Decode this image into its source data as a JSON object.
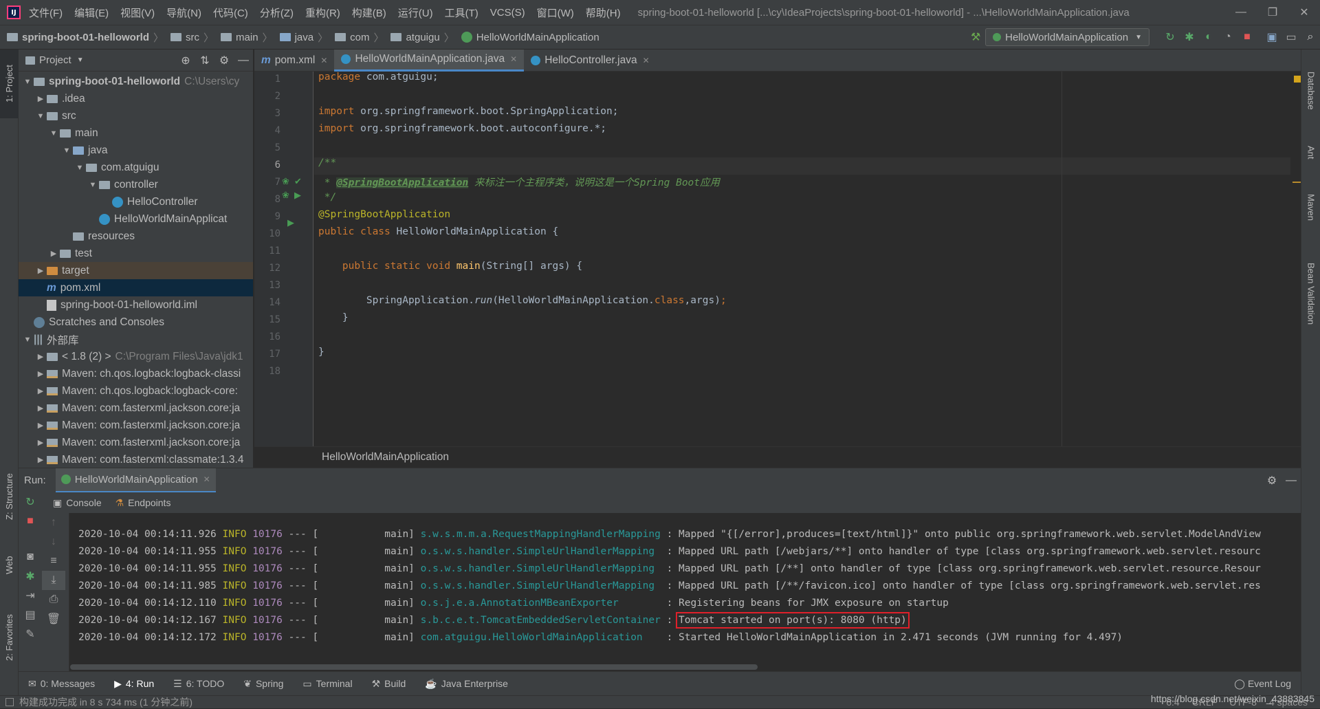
{
  "menubar": {
    "items": [
      "文件(F)",
      "编辑(E)",
      "视图(V)",
      "导航(N)",
      "代码(C)",
      "分析(Z)",
      "重构(R)",
      "构建(B)",
      "运行(U)",
      "工具(T)",
      "VCS(S)",
      "窗口(W)",
      "帮助(H)"
    ],
    "window_title": "spring-boot-01-helloworld [...\\cy\\IdeaProjects\\spring-boot-01-helloworld] - ...\\HelloWorldMainApplication.java"
  },
  "navbar": {
    "crumbs": [
      "spring-boot-01-helloworld",
      "src",
      "main",
      "java",
      "com",
      "atguigu",
      "HelloWorldMainApplication"
    ],
    "run_config": "HelloWorldMainApplication"
  },
  "left_strip": {
    "project": "1: Project",
    "structure": "Z: Structure",
    "web": "Web",
    "favorites": "2: Favorites"
  },
  "right_strip": {
    "database": "Database",
    "ant": "Ant",
    "maven": "Maven",
    "bean_validation": "Bean Validation"
  },
  "project_panel": {
    "title": "Project",
    "tree": [
      {
        "label": "spring-boot-01-helloworld",
        "extra": "C:\\Users\\cy",
        "depth": 0,
        "arrow": "▼",
        "icon": "folder",
        "bold": true
      },
      {
        "label": ".idea",
        "depth": 1,
        "arrow": "▶",
        "icon": "folder"
      },
      {
        "label": "src",
        "depth": 1,
        "arrow": "▼",
        "icon": "folder"
      },
      {
        "label": "main",
        "depth": 2,
        "arrow": "▼",
        "icon": "folder"
      },
      {
        "label": "java",
        "depth": 3,
        "arrow": "▼",
        "icon": "folder-blue"
      },
      {
        "label": "com.atguigu",
        "depth": 4,
        "arrow": "▼",
        "icon": "folder"
      },
      {
        "label": "controller",
        "depth": 5,
        "arrow": "▼",
        "icon": "folder"
      },
      {
        "label": "HelloController",
        "depth": 6,
        "arrow": "",
        "icon": "class"
      },
      {
        "label": "HelloWorldMainApplicat",
        "depth": 5,
        "arrow": "",
        "icon": "class-spring"
      },
      {
        "label": "resources",
        "depth": 3,
        "arrow": "",
        "icon": "folder"
      },
      {
        "label": "test",
        "depth": 2,
        "arrow": "▶",
        "icon": "folder"
      },
      {
        "label": "target",
        "depth": 1,
        "arrow": "▶",
        "icon": "folder-orange",
        "state": "hl"
      },
      {
        "label": "pom.xml",
        "depth": 1,
        "arrow": "",
        "icon": "maven-file",
        "state": "sel"
      },
      {
        "label": "spring-boot-01-helloworld.iml",
        "depth": 1,
        "arrow": "",
        "icon": "file"
      },
      {
        "label": "Scratches and Consoles",
        "depth": 0,
        "arrow": "",
        "icon": "scratch"
      },
      {
        "label": "外部库",
        "depth": 0,
        "arrow": "▼",
        "icon": "library"
      },
      {
        "label": "< 1.8 (2) >",
        "extra": "C:\\Program Files\\Java\\jdk1",
        "depth": 1,
        "arrow": "▶",
        "icon": "folder"
      },
      {
        "label": "Maven: ch.qos.logback:logback-classi",
        "depth": 1,
        "arrow": "▶",
        "icon": "maven-lib"
      },
      {
        "label": "Maven: ch.qos.logback:logback-core:",
        "depth": 1,
        "arrow": "▶",
        "icon": "maven-lib"
      },
      {
        "label": "Maven: com.fasterxml.jackson.core:ja",
        "depth": 1,
        "arrow": "▶",
        "icon": "maven-lib"
      },
      {
        "label": "Maven: com.fasterxml.jackson.core:ja",
        "depth": 1,
        "arrow": "▶",
        "icon": "maven-lib"
      },
      {
        "label": "Maven: com.fasterxml.jackson.core:ja",
        "depth": 1,
        "arrow": "▶",
        "icon": "maven-lib"
      },
      {
        "label": "Maven: com.fasterxml:classmate:1.3.4",
        "depth": 1,
        "arrow": "▶",
        "icon": "maven-lib"
      }
    ]
  },
  "tabs": [
    {
      "label": "pom.xml",
      "icon": "maven-file"
    },
    {
      "label": "HelloWorldMainApplication.java",
      "icon": "class-spring",
      "active": true
    },
    {
      "label": "HelloController.java",
      "icon": "class"
    }
  ],
  "editor": {
    "line_numbers": [
      "1",
      "2",
      "3",
      "4",
      "5",
      "6",
      "7",
      "8",
      "9",
      "10",
      "11",
      "12",
      "13",
      "14",
      "15",
      "16",
      "17",
      "18"
    ],
    "current_line": "6",
    "code": {
      "l1": [
        "package",
        " com.atguigu;"
      ],
      "l3": [
        "import",
        " org.springframework.boot.SpringApplication;"
      ],
      "l4": [
        "import",
        " org.springframework.boot.autoconfigure.*;"
      ],
      "l6": "/**",
      "l7": [
        " * ",
        "@SpringBootApplication",
        " 来标注一个主程序类，说明这是一个Spring Boot应用"
      ],
      "l8": " */",
      "l9": "@SpringBootApplication",
      "l10": [
        "public class",
        " HelloWorldMainApplication {"
      ],
      "l12": [
        "    public static void ",
        "main",
        "(String[] args) {"
      ],
      "l14": [
        "        SpringApplication.",
        "run",
        "(HelloWorldMainApplication.",
        "class",
        ",args)",
        ";"
      ],
      "l15": "    }",
      "l17": "}"
    },
    "breadcrumb": "HelloWorldMainApplication"
  },
  "run_panel": {
    "label": "Run:",
    "config_tab": "HelloWorldMainApplication",
    "subtabs": [
      "Console",
      "Endpoints"
    ],
    "log": [
      {
        "ts": "2020-10-04 00:14:11.926",
        "level": "INFO",
        "pid": "10176",
        "sep": "--- [",
        "thread": "main]",
        "logger": "s.w.s.m.m.a.RequestMappingHandlerMapping",
        "msg": "Mapped \"{[/error],produces=[text/html]}\" onto public org.springframework.web.servlet.ModelAndView"
      },
      {
        "ts": "2020-10-04 00:14:11.955",
        "level": "INFO",
        "pid": "10176",
        "sep": "--- [",
        "thread": "main]",
        "logger": "o.s.w.s.handler.SimpleUrlHandlerMapping",
        "msg": "Mapped URL path [/webjars/**] onto handler of type [class org.springframework.web.servlet.resourc"
      },
      {
        "ts": "2020-10-04 00:14:11.955",
        "level": "INFO",
        "pid": "10176",
        "sep": "--- [",
        "thread": "main]",
        "logger": "o.s.w.s.handler.SimpleUrlHandlerMapping",
        "msg": "Mapped URL path [/**] onto handler of type [class org.springframework.web.servlet.resource.Resour"
      },
      {
        "ts": "2020-10-04 00:14:11.985",
        "level": "INFO",
        "pid": "10176",
        "sep": "--- [",
        "thread": "main]",
        "logger": "o.s.w.s.handler.SimpleUrlHandlerMapping",
        "msg": "Mapped URL path [/**/favicon.ico] onto handler of type [class org.springframework.web.servlet.res"
      },
      {
        "ts": "2020-10-04 00:14:12.110",
        "level": "INFO",
        "pid": "10176",
        "sep": "--- [",
        "thread": "main]",
        "logger": "o.s.j.e.a.AnnotationMBeanExporter",
        "msg": "Registering beans for JMX exposure on startup"
      },
      {
        "ts": "2020-10-04 00:14:12.167",
        "level": "INFO",
        "pid": "10176",
        "sep": "--- [",
        "thread": "main]",
        "logger": "s.b.c.e.t.TomcatEmbeddedServletContainer",
        "msg": "Tomcat started on port(s): 8080 (http)",
        "highlight": true
      },
      {
        "ts": "2020-10-04 00:14:12.172",
        "level": "INFO",
        "pid": "10176",
        "sep": "--- [",
        "thread": "main]",
        "logger": "com.atguigu.HelloWorldMainApplication",
        "msg": "Started HelloWorldMainApplication in 2.471 seconds (JVM running for 4.497)"
      }
    ]
  },
  "bottom_tabs": [
    "0: Messages",
    "4: Run",
    "6: TODO",
    "Spring",
    "Terminal",
    "Build",
    "Java Enterprise"
  ],
  "event_log": "Event Log",
  "status": {
    "message": "构建成功完成 in 8 s 734 ms (1 分钟之前)",
    "position": "6:4",
    "line_sep": "CRLF",
    "encoding": "UTF-8",
    "indent": "4 spaces",
    "watermark": "https://blog.csdn.net/weixin_43883845"
  }
}
